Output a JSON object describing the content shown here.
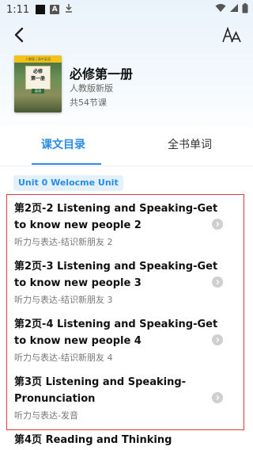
{
  "status_bar": {
    "time": "1:11"
  },
  "header": {
    "back_icon": "chevron-left-icon",
    "font_icon": "text-size-icon"
  },
  "book": {
    "title": "必修第一册",
    "edition": "人教版新版",
    "lessons_count": "共54节课",
    "cover_top_text": "人教版 | 高中英语",
    "cover_title_line1": "必修",
    "cover_title_line2": "第一册",
    "cover_badge": "英语"
  },
  "tabs": [
    {
      "label": "课文目录",
      "active": true
    },
    {
      "label": "全书单词",
      "active": false
    }
  ],
  "unit": {
    "label": "Unit 0 Welocme Unit"
  },
  "lessons": [
    {
      "title": "第2页-2 Listening and Speaking-Get to know new people 2",
      "subtitle": "听力与表达-结识新朋友 2"
    },
    {
      "title": "第2页-3 Listening and Speaking-Get to know new people 3",
      "subtitle": "听力与表达-结识新朋友 3"
    },
    {
      "title": "第2页-4 Listening and Speaking-Get to know new people 4",
      "subtitle": "听力与表达-结识新朋友 4"
    },
    {
      "title": "第3页 Listening and Speaking-Pronunciation",
      "subtitle": "听力与表达-发音"
    },
    {
      "title": "第4页 Reading and Thinking",
      "subtitle": ""
    }
  ],
  "colors": {
    "accent": "#2a8ce6",
    "highlight_border": "#e53935"
  }
}
